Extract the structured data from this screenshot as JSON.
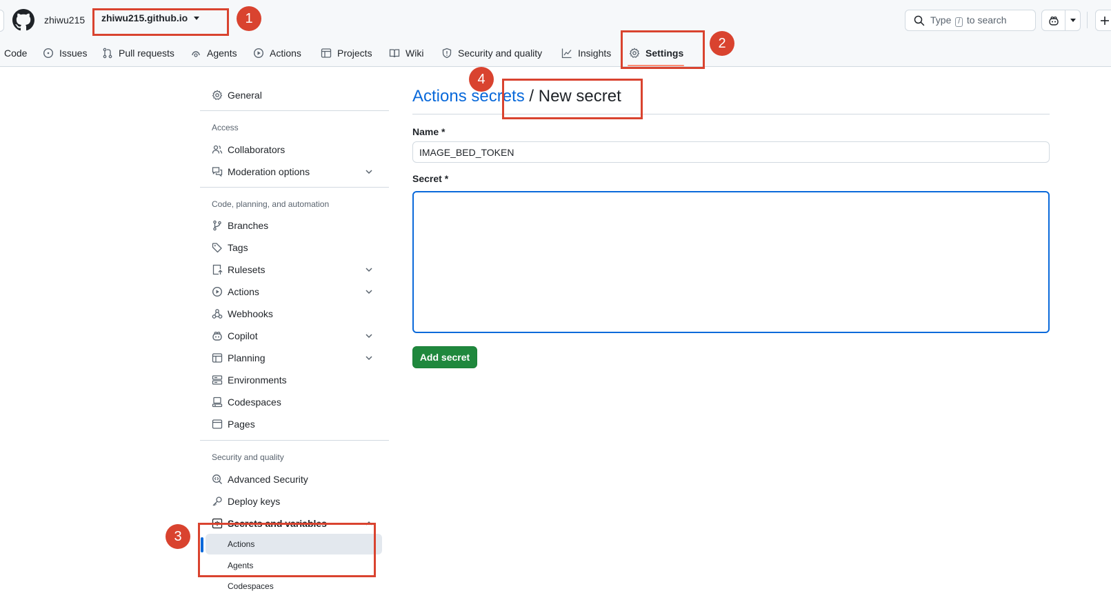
{
  "header": {
    "owner": "zhiwu215",
    "repo": "zhiwu215.github.io",
    "search": {
      "prefix": "Type",
      "key": "/",
      "suffix": "to search"
    }
  },
  "tabs": [
    {
      "label": "Code",
      "icon": "code-icon"
    },
    {
      "label": "Issues",
      "icon": "issue-icon"
    },
    {
      "label": "Pull requests",
      "icon": "pull-request-icon"
    },
    {
      "label": "Agents",
      "icon": "agents-icon"
    },
    {
      "label": "Actions",
      "icon": "play-icon"
    },
    {
      "label": "Projects",
      "icon": "table-icon"
    },
    {
      "label": "Wiki",
      "icon": "book-icon"
    },
    {
      "label": "Security and quality",
      "icon": "shield-icon"
    },
    {
      "label": "Insights",
      "icon": "graph-icon"
    },
    {
      "label": "Settings",
      "icon": "gear-icon",
      "active": true
    }
  ],
  "sidebar": {
    "general": "General",
    "headings": {
      "access": "Access",
      "code": "Code, planning, and automation",
      "security": "Security and quality"
    },
    "access_items": [
      "Collaborators",
      "Moderation options"
    ],
    "code_items": [
      "Branches",
      "Tags",
      "Rulesets",
      "Actions",
      "Webhooks",
      "Copilot",
      "Planning",
      "Environments",
      "Codespaces",
      "Pages"
    ],
    "security_items": [
      "Advanced Security",
      "Deploy keys",
      "Secrets and variables"
    ],
    "secrets_sub": [
      "Actions",
      "Agents",
      "Codespaces"
    ]
  },
  "main": {
    "breadcrumb_link": "Actions secrets",
    "breadcrumb_sep": " / ",
    "breadcrumb_current": "New secret",
    "name_label": "Name *",
    "name_value": "IMAGE_BED_TOKEN",
    "secret_label": "Secret *",
    "secret_value": "",
    "add_button": "Add secret"
  },
  "annotations": [
    "1",
    "2",
    "3",
    "4"
  ],
  "colors": {
    "annotation": "#d9432f",
    "primary_button": "#1f883d",
    "link": "#0969da"
  }
}
